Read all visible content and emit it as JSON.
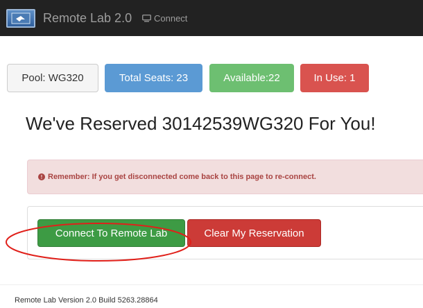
{
  "navbar": {
    "brand": "Remote Lab 2.0",
    "connect_label": "Connect"
  },
  "stats": {
    "pool": "Pool: WG320",
    "total_seats": "Total Seats: 23",
    "available": "Available:22",
    "in_use": "In Use: 1"
  },
  "heading": "We've Reserved 30142539WG320 For You!",
  "alert": {
    "icon": "!",
    "text": "Remember: If you get disconnected come back to this page to re-connect."
  },
  "actions": {
    "connect_label": "Connect To Remote Lab",
    "clear_label": "Clear My Reservation"
  },
  "footer": "Remote Lab Version 2.0 Build 5263.28864",
  "colors": {
    "navbar": "#222222",
    "info": "#5b9ad4",
    "success": "#6dbf71",
    "danger": "#d9534f",
    "annotation": "#e0201a"
  }
}
